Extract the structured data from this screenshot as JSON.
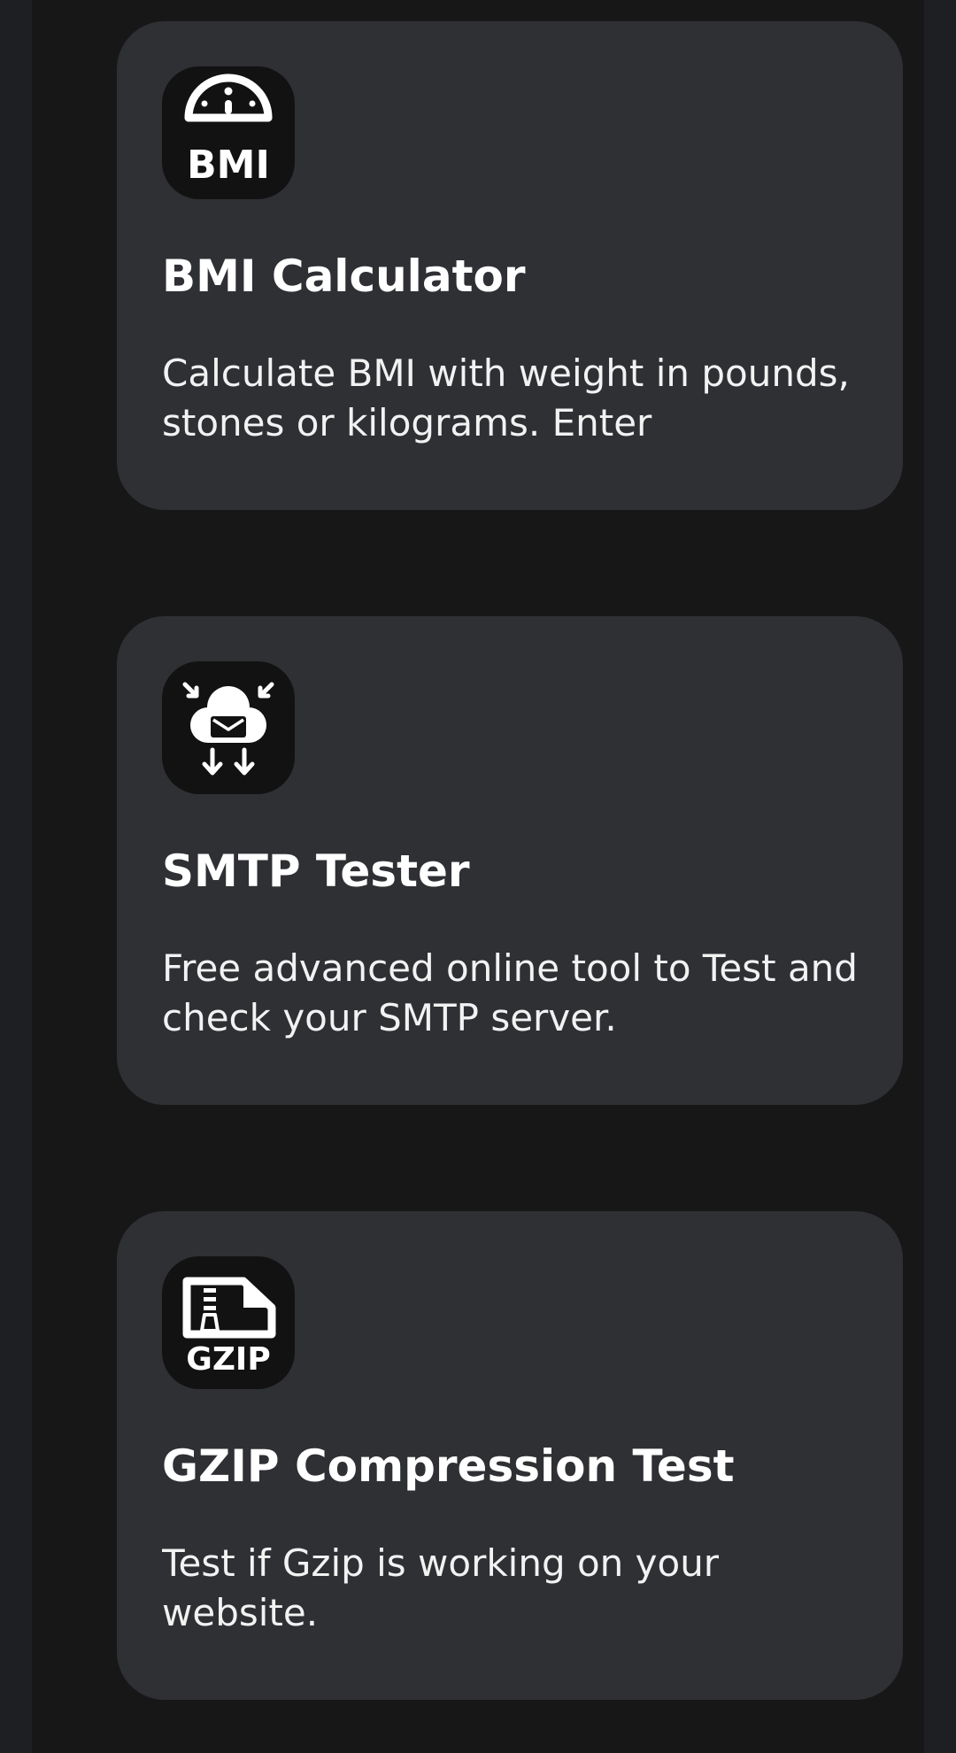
{
  "cards": [
    {
      "icon": "bmi-gauge-icon",
      "icon_text": "BMI",
      "title": "BMI Calculator",
      "description": "Calculate BMI with weight in pounds, stones or kilograms. Enter"
    },
    {
      "icon": "smtp-mail-cloud-icon",
      "title": "SMTP Tester",
      "description": "Free advanced online tool to Test and check your SMTP server."
    },
    {
      "icon": "gzip-zipped-file-icon",
      "icon_text": "GZIP",
      "title": "GZIP Compression Test",
      "description": "Test if Gzip is working on your website."
    }
  ],
  "colors": {
    "page_edge": "#1e1f22",
    "page_background": "#171718",
    "card_background": "#2f3034",
    "icon_tile": "#121212",
    "text": "#ffffff"
  }
}
